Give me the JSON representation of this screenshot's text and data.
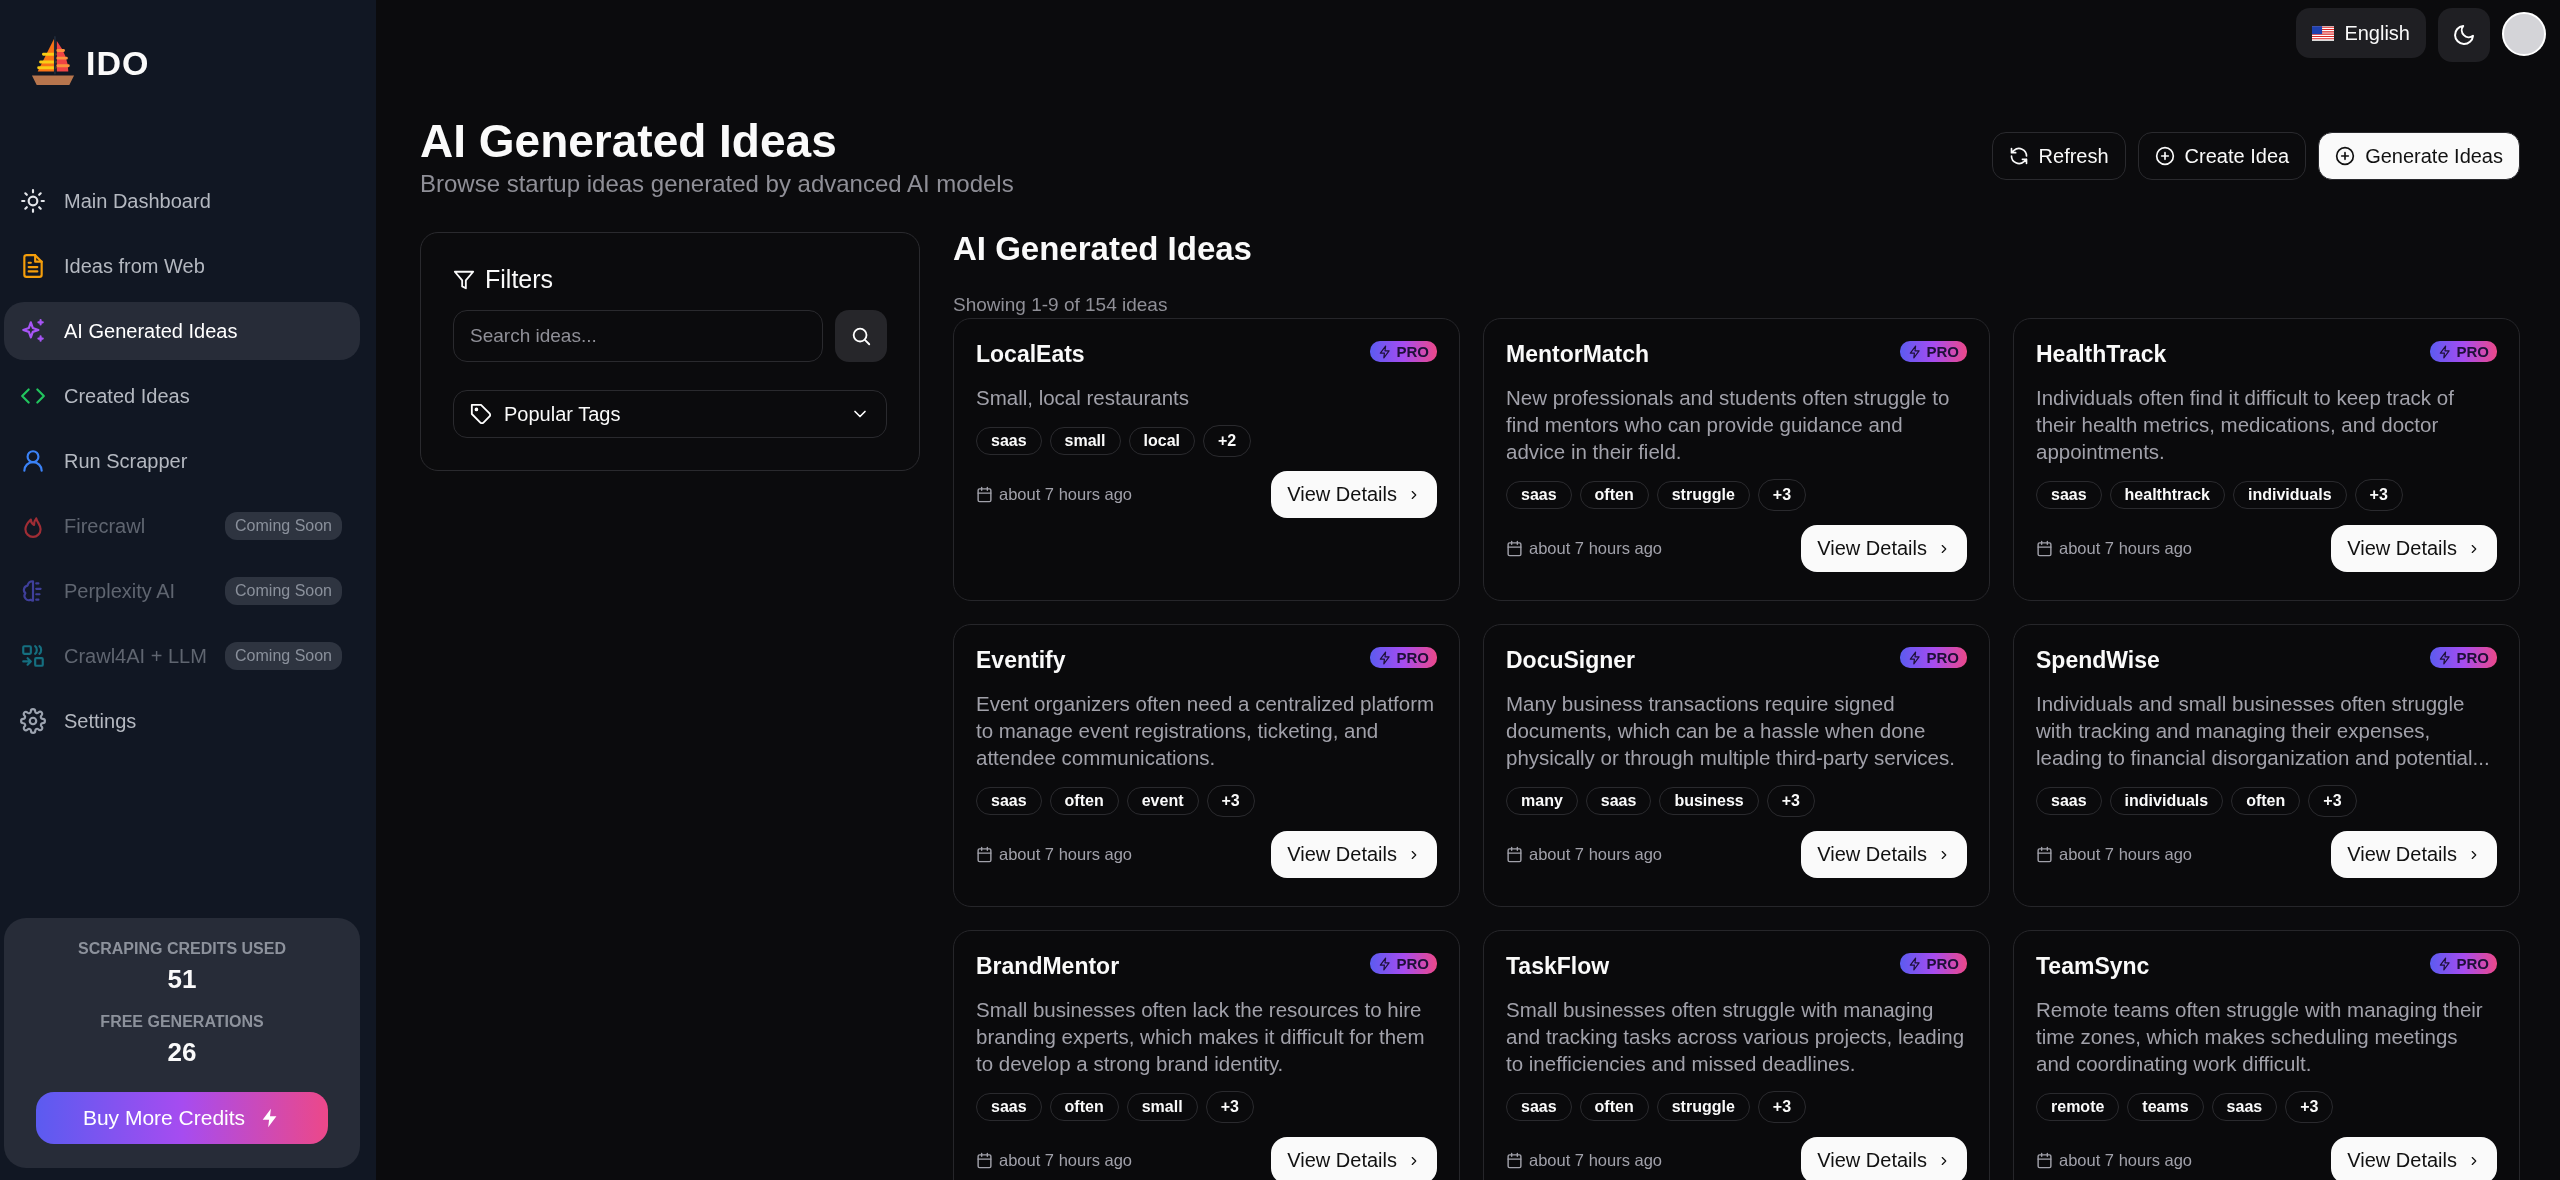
{
  "brand": {
    "name": "IDO"
  },
  "sidebar": {
    "items": [
      {
        "label": "Main Dashboard",
        "selected": false,
        "disabled": false,
        "color": "#e5e7eb"
      },
      {
        "label": "Ideas from Web",
        "selected": false,
        "disabled": false,
        "color": "#f59e0b"
      },
      {
        "label": "AI Generated Ideas",
        "selected": true,
        "disabled": false,
        "color": "#a855f7"
      },
      {
        "label": "Created Ideas",
        "selected": false,
        "disabled": false,
        "color": "#22c55e"
      },
      {
        "label": "Run Scrapper",
        "selected": false,
        "disabled": false,
        "color": "#3b82f6"
      },
      {
        "label": "Firecrawl",
        "selected": false,
        "disabled": true,
        "color": "#9f2d35",
        "badge": "Coming Soon"
      },
      {
        "label": "Perplexity AI",
        "selected": false,
        "disabled": true,
        "color": "#3f3f9a",
        "badge": "Coming Soon"
      },
      {
        "label": "Crawl4AI + LLM",
        "selected": false,
        "disabled": true,
        "color": "#156f80",
        "badge": "Coming Soon"
      },
      {
        "label": "Settings",
        "selected": false,
        "disabled": false,
        "color": "#9ca3af"
      }
    ],
    "credits": {
      "scraping_label": "SCRAPING CREDITS USED",
      "scraping_value": "51",
      "free_label": "FREE GENERATIONS",
      "free_value": "26",
      "button": "Buy More Credits"
    }
  },
  "topbar": {
    "language": "English"
  },
  "header": {
    "title": "AI Generated Ideas",
    "subtitle": "Browse startup ideas generated by advanced AI models",
    "buttons": [
      {
        "label": "Refresh",
        "kind": "refresh"
      },
      {
        "label": "Create Idea",
        "kind": "create"
      },
      {
        "label": "Generate Ideas",
        "kind": "generate"
      }
    ]
  },
  "filters": {
    "title": "Filters",
    "search": {
      "placeholder": "Search ideas..."
    },
    "tags_dropdown": "Popular Tags"
  },
  "results": {
    "title": "AI Generated Ideas",
    "summary": "Showing 1-9 of 154 ideas",
    "cards": [
      {
        "title": "LocalEats",
        "badge": "PRO",
        "description": "Small, local restaurants",
        "tags": [
          "saas",
          "small",
          "local"
        ],
        "more": "+2",
        "date": "about 7 hours ago",
        "button": "View Details"
      },
      {
        "title": "MentorMatch",
        "badge": "PRO",
        "description": "New professionals and students often struggle to find mentors who can provide guidance and advice in their field.",
        "tags": [
          "saas",
          "often",
          "struggle"
        ],
        "more": "+3",
        "date": "about 7 hours ago",
        "button": "View Details"
      },
      {
        "title": "HealthTrack",
        "badge": "PRO",
        "description": "Individuals often find it difficult to keep track of their health metrics, medications, and doctor appointments.",
        "tags": [
          "saas",
          "healthtrack",
          "individuals"
        ],
        "more": "+3",
        "date": "about 7 hours ago",
        "button": "View Details"
      },
      {
        "title": "Eventify",
        "badge": "PRO",
        "description": "Event organizers often need a centralized platform to manage event registrations, ticketing, and attendee communications.",
        "tags": [
          "saas",
          "often",
          "event"
        ],
        "more": "+3",
        "date": "about 7 hours ago",
        "button": "View Details"
      },
      {
        "title": "DocuSigner",
        "badge": "PRO",
        "description": "Many business transactions require signed documents, which can be a hassle when done physically or through multiple third-party services.",
        "tags": [
          "many",
          "saas",
          "business"
        ],
        "more": "+3",
        "date": "about 7 hours ago",
        "button": "View Details"
      },
      {
        "title": "SpendWise",
        "badge": "PRO",
        "description": "Individuals and small businesses often struggle with tracking and managing their expenses, leading to financial disorganization and potential...",
        "tags": [
          "saas",
          "individuals",
          "often"
        ],
        "more": "+3",
        "date": "about 7 hours ago",
        "button": "View Details"
      },
      {
        "title": "BrandMentor",
        "badge": "PRO",
        "description": "Small businesses often lack the resources to hire branding experts, which makes it difficult for them to develop a strong brand identity.",
        "tags": [
          "saas",
          "often",
          "small"
        ],
        "more": "+3",
        "date": "about 7 hours ago",
        "button": "View Details"
      },
      {
        "title": "TaskFlow",
        "badge": "PRO",
        "description": "Small businesses often struggle with managing and tracking tasks across various projects, leading to inefficiencies and missed deadlines.",
        "tags": [
          "saas",
          "often",
          "struggle"
        ],
        "more": "+3",
        "date": "about 7 hours ago",
        "button": "View Details"
      },
      {
        "title": "TeamSync",
        "badge": "PRO",
        "description": "Remote teams often struggle with managing their time zones, which makes scheduling meetings and coordinating work difficult.",
        "tags": [
          "remote",
          "teams",
          "saas"
        ],
        "more": "+3",
        "date": "about 7 hours ago",
        "button": "View Details"
      }
    ]
  }
}
